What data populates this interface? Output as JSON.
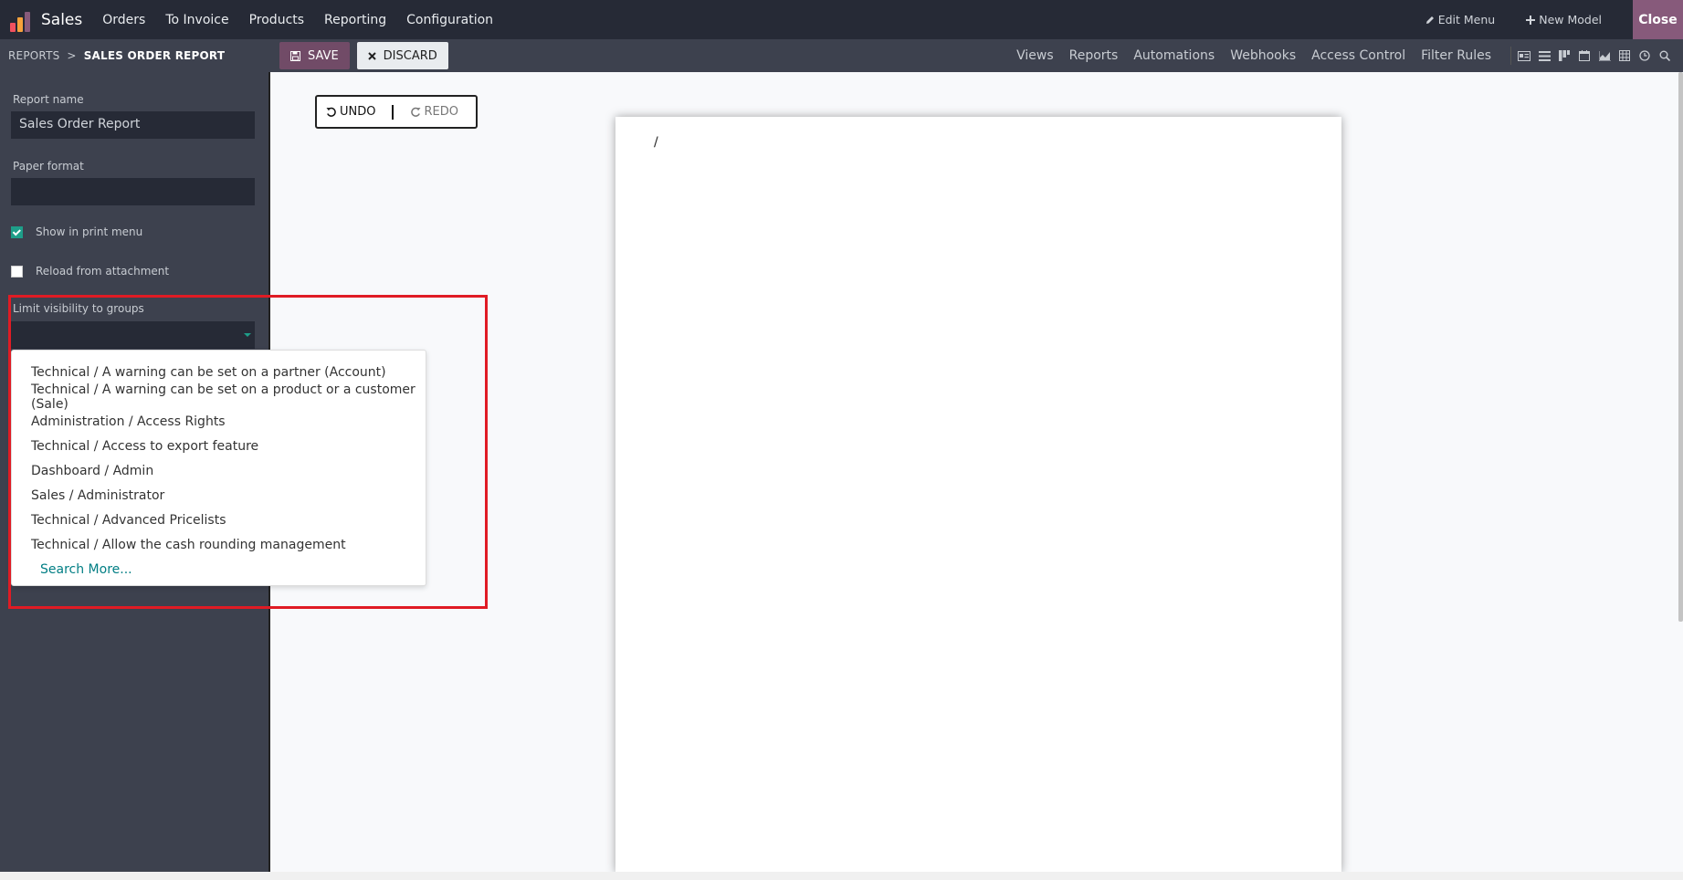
{
  "topbar": {
    "app_name": "Sales",
    "menu": [
      "Orders",
      "To Invoice",
      "Products",
      "Reporting",
      "Configuration"
    ],
    "edit_menu": "Edit Menu",
    "new_model": "New Model",
    "close": "Close",
    "logo_colors": [
      "#f0515f",
      "#f7a23b",
      "#875a7b"
    ]
  },
  "subbar": {
    "breadcrumb_parent": "REPORTS",
    "breadcrumb_sep": ">",
    "breadcrumb_current": "SALES ORDER REPORT",
    "save_label": "SAVE",
    "discard_label": "DISCARD",
    "links": [
      "Views",
      "Reports",
      "Automations",
      "Webhooks",
      "Access Control",
      "Filter Rules"
    ],
    "view_icons": [
      "form-view-icon",
      "list-view-icon",
      "kanban-view-icon",
      "calendar-view-icon",
      "graph-view-icon",
      "pivot-view-icon",
      "activity-view-icon",
      "search-view-icon"
    ]
  },
  "sidebar": {
    "report_name_label": "Report name",
    "report_name_value": "Sales Order Report",
    "paper_format_label": "Paper format",
    "paper_format_value": "",
    "show_in_print_label": "Show in print menu",
    "show_in_print_checked": true,
    "reload_label": "Reload from attachment",
    "reload_checked": false,
    "groups_label": "Limit visibility to groups",
    "groups_value": ""
  },
  "dropdown": {
    "items": [
      "Technical / A warning can be set on a partner (Account)",
      "Technical / A warning can be set on a product or a customer (Sale)",
      "Administration / Access Rights",
      "Technical / Access to export feature",
      "Dashboard / Admin",
      "Sales / Administrator",
      "Technical / Advanced Pricelists",
      "Technical / Allow the cash rounding management"
    ],
    "search_more": "Search More..."
  },
  "editor": {
    "undo_label": "UNDO",
    "redo_label": "REDO",
    "paper_text": "/"
  },
  "colors": {
    "topbar_bg": "#262a36",
    "subbar_bg": "#3d414e",
    "accent": "#714b67",
    "close_bg": "#875a7b",
    "checkbox_on": "#1e9e89",
    "link": "#017e84",
    "highlight": "#e01b24"
  }
}
